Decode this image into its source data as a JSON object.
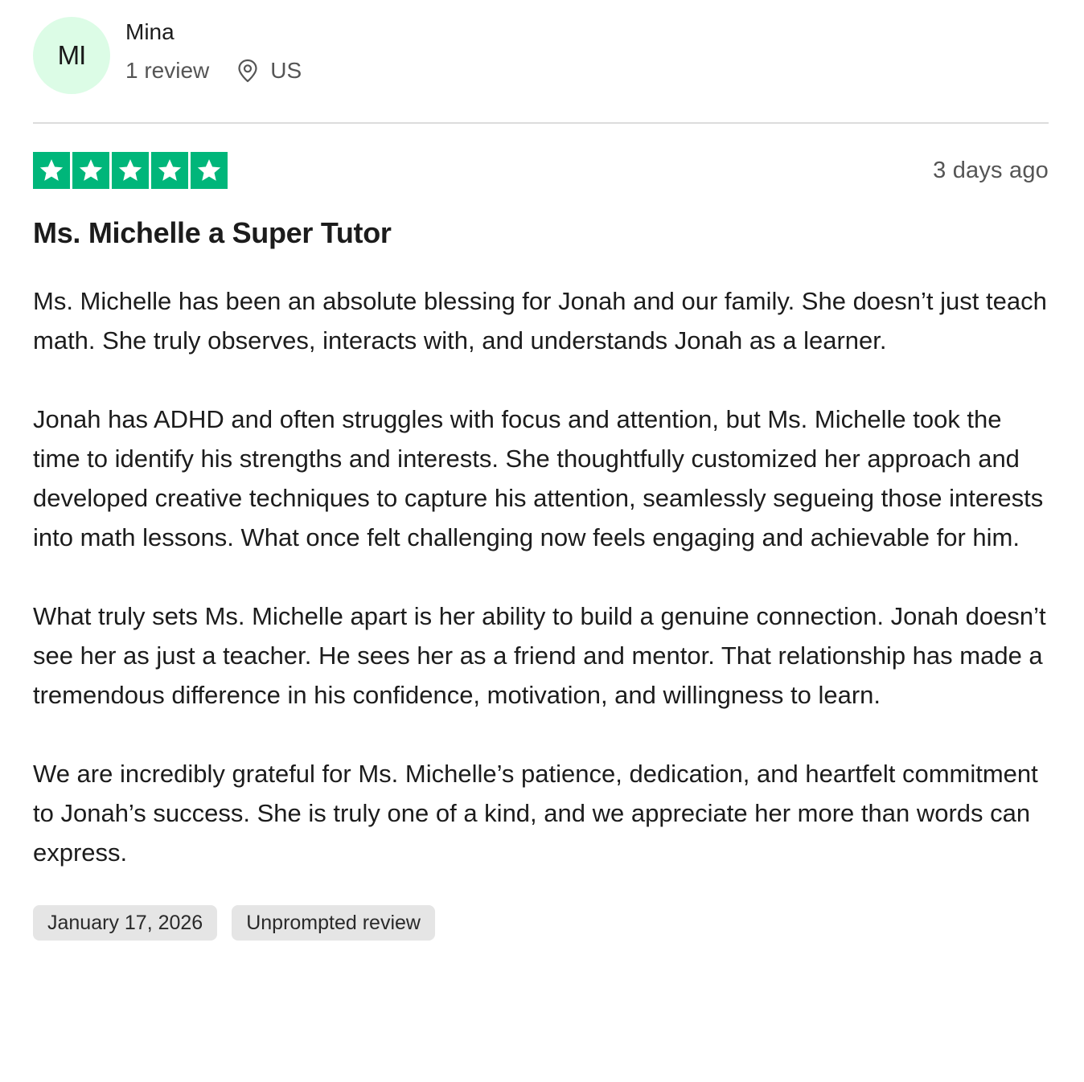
{
  "reviewer": {
    "initials": "MI",
    "name": "Mina",
    "review_count": "1 review",
    "location_icon": "location-pin-icon",
    "location": "US"
  },
  "review": {
    "rating": 5,
    "rating_max": 5,
    "star_color": "#00b67a",
    "date_ago": "3 days ago",
    "title": "Ms. Michelle a Super Tutor",
    "paragraphs": [
      "Ms. Michelle has been an absolute blessing for Jonah and our family. She doesn’t just teach math.  She truly observes, interacts with, and understands Jonah as a learner.",
      "Jonah has ADHD and often struggles with focus and attention, but Ms. Michelle took the time to identify his strengths and interests. She thoughtfully customized her approach and developed creative techniques to capture his attention, seamlessly segueing those interests into math lessons. What once felt challenging now feels engaging and achievable for him.",
      "What truly sets Ms. Michelle apart is her ability to build a genuine connection. Jonah doesn’t see her as just a teacher.  He sees her as a friend and mentor. That relationship has made a tremendous difference in his confidence, motivation, and willingness to learn.",
      "We are incredibly grateful for Ms. Michelle’s patience, dedication, and heartfelt commitment to Jonah’s success. She is truly one of a kind, and we appreciate her more than words can express."
    ],
    "experience_date": "January 17, 2026",
    "review_type": "Unprompted review"
  },
  "colors": {
    "avatar_bg": "#dcfce6",
    "tag_bg": "#e5e5e5",
    "muted_text": "#555555"
  }
}
